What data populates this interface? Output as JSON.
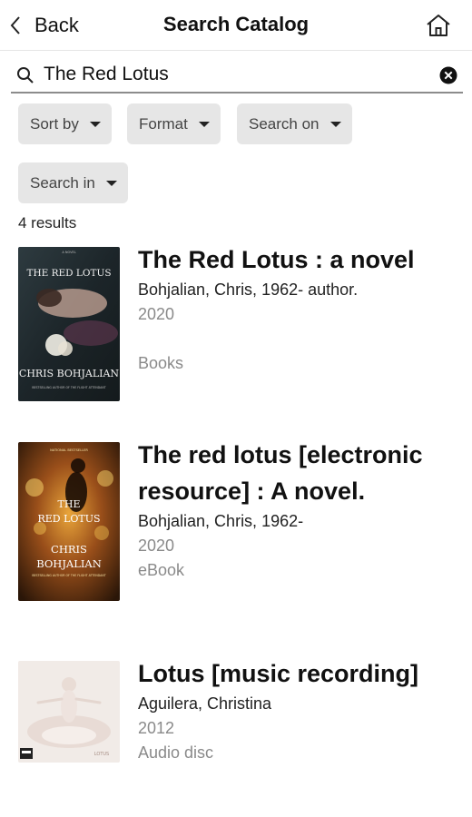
{
  "header": {
    "back_label": "Back",
    "title": "Search Catalog"
  },
  "search": {
    "value": "The Red Lotus"
  },
  "filters": [
    {
      "label": "Sort by"
    },
    {
      "label": "Format"
    },
    {
      "label": "Search on"
    },
    {
      "label": "Search in"
    }
  ],
  "results_count": "4 results",
  "results": [
    {
      "title": "The Red Lotus : a novel",
      "author": "Bohjalian, Chris, 1962- author.",
      "year": "2020",
      "format": "Books",
      "cover": {
        "top_line": "A NOVEL",
        "title": "THE RED LOTUS",
        "author": "CHRIS BOHJALIAN",
        "tagline": "BESTSELLING AUTHOR OF THE FLIGHT ATTENDANT"
      }
    },
    {
      "title": "The red lotus [electronic resource] : A novel.",
      "author": "Bohjalian, Chris, 1962-",
      "year": "2020",
      "format": "eBook",
      "cover": {
        "top_line": "NATIONAL BESTSELLER",
        "title_1": "THE",
        "title_2": "RED LOTUS",
        "author_1": "CHRIS",
        "author_2": "BOHJALIAN",
        "tagline": "BESTSELLING AUTHOR OF THE FLIGHT ATTENDANT"
      }
    },
    {
      "title": "Lotus [music recording]",
      "author": "Aguilera, Christina",
      "year": "2012",
      "format": "Audio disc",
      "cover": {
        "title": "LOTUS"
      }
    }
  ],
  "colors": {
    "chip_bg": "#e6e6e6",
    "muted_text": "#8a8a8a",
    "cover1_bg": "#1f2a2f",
    "cover2_bg": "#3a2210",
    "cover3_bg": "#f1ebe7"
  }
}
